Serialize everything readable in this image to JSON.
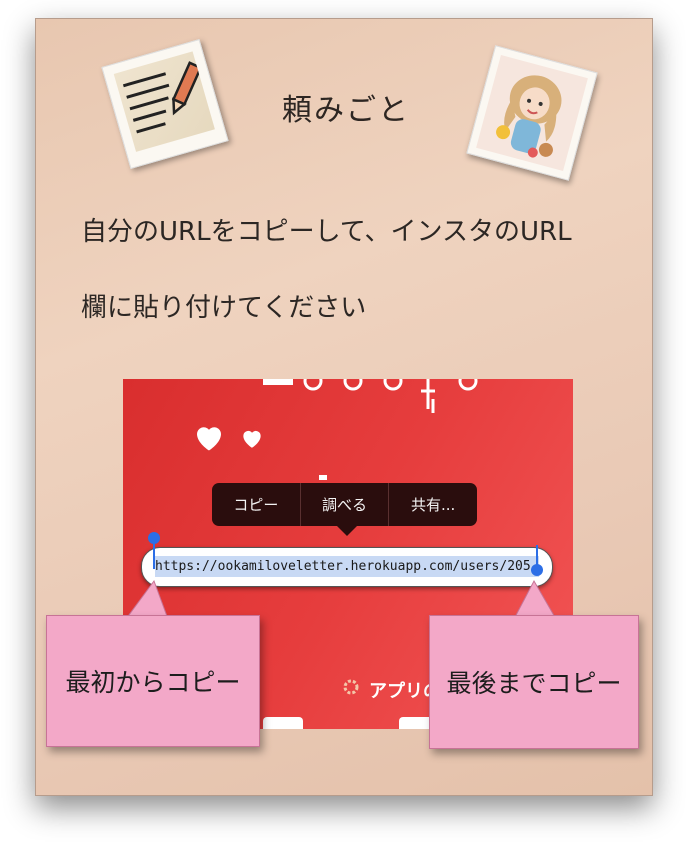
{
  "card": {
    "title": "頼みごと",
    "instruction_line1": "自分のURLをコピーして、インスタのURL",
    "instruction_line2": "欄に貼り付けてください"
  },
  "icons": {
    "note": "note-with-pencil-icon",
    "doll": "doll-illustration-icon",
    "hearts": "heart-icon"
  },
  "screenshot": {
    "context_menu": [
      "コピー",
      "調べる",
      "共有..."
    ],
    "url_text": "https://ookamiloveletter.herokuapp.com/users/205",
    "app_feature_label": "アプリの機能"
  },
  "callouts": {
    "left": "最初からコピー",
    "right": "最後までコピー"
  },
  "colors": {
    "card_background": "#efd3bf",
    "screenshot_red": "#e63d3d",
    "callout_pink": "#f3a8c8",
    "selection_blue": "#c8d9f4",
    "handle_blue": "#2c6ee6"
  }
}
